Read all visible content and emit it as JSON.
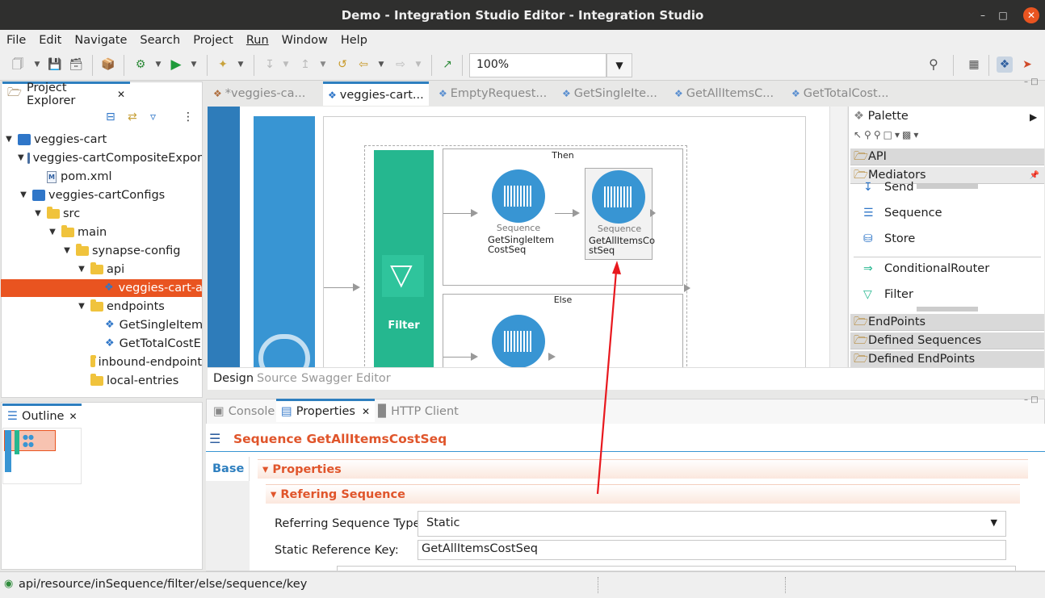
{
  "window": {
    "title": "Demo - Integration Studio Editor - Integration Studio"
  },
  "menu": [
    "File",
    "Edit",
    "Navigate",
    "Search",
    "Project",
    "Run",
    "Window",
    "Help"
  ],
  "toolbar": {
    "zoom": "100%"
  },
  "project_explorer": {
    "title": "Project Explorer",
    "items": [
      {
        "label": "veggies-cart",
        "type": "project"
      },
      {
        "label": "veggies-cartCompositeExpor",
        "type": "composite"
      },
      {
        "label": "pom.xml",
        "type": "xml"
      },
      {
        "label": "veggies-cartConfigs",
        "type": "project"
      },
      {
        "label": "src",
        "type": "folder"
      },
      {
        "label": "main",
        "type": "folder"
      },
      {
        "label": "synapse-config",
        "type": "folder"
      },
      {
        "label": "api",
        "type": "folder"
      },
      {
        "label": "veggies-cart-api",
        "type": "api",
        "selected": true
      },
      {
        "label": "endpoints",
        "type": "folder"
      },
      {
        "label": "GetSingleItemF",
        "type": "endpoint"
      },
      {
        "label": "GetTotalCostEF",
        "type": "endpoint"
      },
      {
        "label": "inbound-endpoint",
        "type": "folder"
      },
      {
        "label": "local-entries",
        "type": "folder"
      }
    ]
  },
  "outline": {
    "title": "Outline"
  },
  "editor_tabs": [
    {
      "label": "*veggies-ca...",
      "active": false
    },
    {
      "label": "veggies-cart...",
      "active": true
    },
    {
      "label": "EmptyRequest...",
      "active": false
    },
    {
      "label": "GetSingleIte...",
      "active": false
    },
    {
      "label": "GetAllItemsC...",
      "active": false
    },
    {
      "label": "GetTotalCost...",
      "active": false
    }
  ],
  "canvas": {
    "then_label": "Then",
    "else_label": "Else",
    "filter_label": "Filter",
    "seq1": {
      "type": "Sequence",
      "name_line1": "GetSingleItem",
      "name_line2": "CostSeq"
    },
    "seq2": {
      "type": "Sequence",
      "name_line1": "GetAllItemsCo",
      "name_line2": "stSeq"
    }
  },
  "editor_bottom_tabs": [
    "Design",
    "Source",
    "Swagger Editor"
  ],
  "palette": {
    "title": "Palette",
    "drawers": [
      "API",
      "Mediators",
      "EndPoints",
      "Defined Sequences",
      "Defined EndPoints"
    ],
    "mediators": [
      "Send",
      "Sequence",
      "Store",
      "ConditionalRouter",
      "Filter"
    ]
  },
  "bottom_tabs": [
    {
      "label": "Console",
      "active": false
    },
    {
      "label": "Properties",
      "active": true
    },
    {
      "label": "HTTP Client",
      "active": false
    }
  ],
  "properties": {
    "title": "Sequence GetAllItemsCostSeq",
    "side_tab": "Base",
    "section": "Properties",
    "subsection": "Refering Sequence",
    "fields": [
      {
        "label": "Referring Sequence Type:",
        "value": "Static"
      },
      {
        "label": "Static Reference Key:",
        "value": "GetAllItemsCostSeq"
      }
    ]
  },
  "status": {
    "path": "api/resource/inSequence/filter/else/sequence/key"
  },
  "colors": {
    "accent_blue": "#3895d3",
    "filter_green": "#25b78f",
    "selection_orange": "#e95420",
    "annotation_red": "#e8181e"
  }
}
